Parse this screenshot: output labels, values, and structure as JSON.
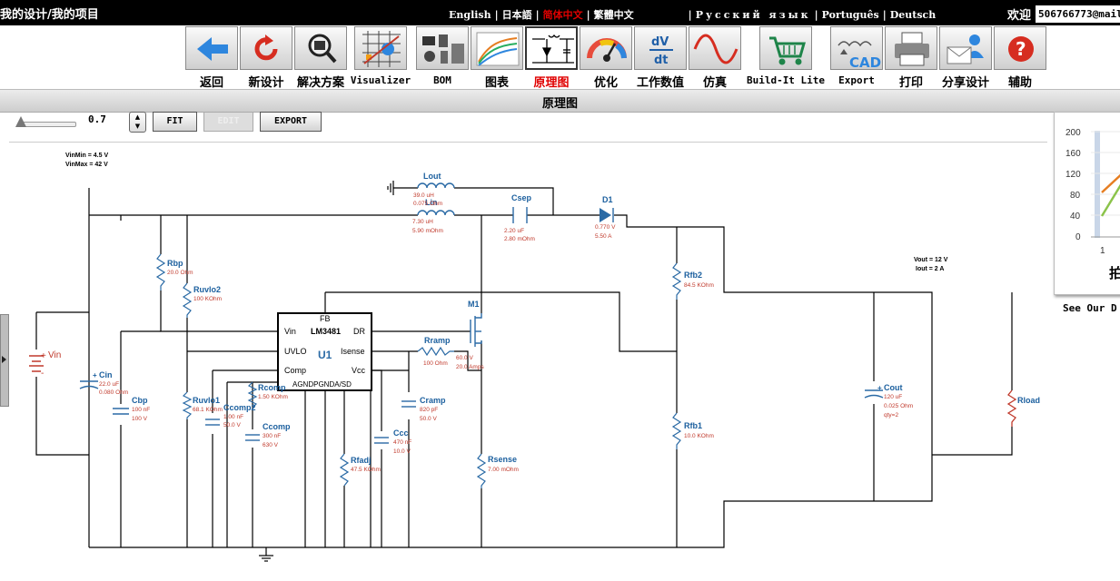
{
  "header": {
    "breadcrumb": "我的设计/我的项目",
    "languages": [
      "English",
      "日本語",
      "简体中文",
      "繁體中文",
      "Русский язык",
      "Português",
      "Deutsch"
    ],
    "active_language": "简体中文",
    "welcome": "欢迎",
    "user": "506766773@mail"
  },
  "toolbar": {
    "items": [
      {
        "key": "back",
        "label": "返回",
        "icon": "back-arrow-icon"
      },
      {
        "key": "new",
        "label": "新设计",
        "icon": "refresh-icon"
      },
      {
        "key": "solutions",
        "label": "解决方案",
        "icon": "magnifier-chip-icon"
      },
      {
        "key": "visualizer",
        "label": "Visualizer",
        "icon": "visualizer-icon"
      },
      {
        "key": "bom",
        "label": "BOM",
        "icon": "bom-icon"
      },
      {
        "key": "charts",
        "label": "图表",
        "icon": "chart-icon"
      },
      {
        "key": "schematic",
        "label": "原理图",
        "icon": "schematic-icon",
        "selected": true
      },
      {
        "key": "optimize",
        "label": "优化",
        "icon": "gauge-icon"
      },
      {
        "key": "opvalues",
        "label": "工作数值",
        "icon": "dvdt-icon"
      },
      {
        "key": "simulate",
        "label": "仿真",
        "icon": "sine-icon"
      },
      {
        "key": "buildit",
        "label": "Build-It Lite",
        "icon": "cart-icon"
      },
      {
        "key": "export",
        "label": "Export",
        "icon": "cad-icon"
      },
      {
        "key": "print",
        "label": "打印",
        "icon": "printer-icon"
      },
      {
        "key": "share",
        "label": "分享设计",
        "icon": "share-icon"
      },
      {
        "key": "help",
        "label": "辅助",
        "icon": "help-icon"
      }
    ]
  },
  "section_title": "原理图",
  "controls": {
    "zoom": "0.7",
    "fit": "FIT",
    "edit": "EDIT",
    "export": "EXPORT"
  },
  "schematic": {
    "vin_range": [
      "VinMin = 4.5 V",
      "VinMax = 42 V"
    ],
    "vout_info": [
      "Vout = 12 V",
      "Iout = 2 A"
    ],
    "source": {
      "name": "Vin"
    },
    "ic": {
      "name": "LM3481",
      "ref": "U1",
      "pins": {
        "fb": "FB",
        "vin": "Vin",
        "dr": "DR",
        "uvlo": "UVLO",
        "isense": "Isense",
        "comp": "Comp",
        "vcc": "Vcc",
        "bottom": "AGNDPGNDA/SD"
      }
    },
    "parts": {
      "lout": {
        "name": "Lout",
        "v1": "39.0 uH",
        "v2": "0.075 Ohm"
      },
      "lin": {
        "name": "Lin",
        "v1": "7.30 uH",
        "v2": "5.90 mOhm"
      },
      "csep": {
        "name": "Csep",
        "v1": "2.20 uF",
        "v2": "2.80 mOhm"
      },
      "d1": {
        "name": "D1",
        "v1": "0.770 V",
        "v2": "5.50 A"
      },
      "rbp": {
        "name": "Rbp",
        "v1": "20.0 Ohm"
      },
      "ruvlo2": {
        "name": "Ruvlo2",
        "v1": "100 KOhm"
      },
      "rfb2": {
        "name": "Rfb2",
        "v1": "84.5 KOhm"
      },
      "m1": {
        "name": "M1",
        "v1": "60.0 V",
        "v2": "20.0 Amps"
      },
      "rramp": {
        "name": "Rramp",
        "v1": "100 Ohm"
      },
      "cin": {
        "name": "Cin",
        "v1": "22.0 uF",
        "v2": "0.080 Ohm"
      },
      "cbp": {
        "name": "Cbp",
        "v1": "100 nF",
        "v2": "100 V"
      },
      "ruvlo1": {
        "name": "Ruvlo1",
        "v1": "68.1 KOhm"
      },
      "ccomp2": {
        "name": "Ccomp2",
        "v1": "1.00 nF",
        "v2": "50.0 V"
      },
      "rcomp": {
        "name": "Rcomp",
        "v1": "1.50 KOhm"
      },
      "ccomp": {
        "name": "Ccomp",
        "v1": "300 nF",
        "v2": "630 V"
      },
      "cramp": {
        "name": "Cramp",
        "v1": "820 pF",
        "v2": "50.0 V"
      },
      "ccc": {
        "name": "Ccc",
        "v1": "470 nF",
        "v2": "10.0 V"
      },
      "rfadj": {
        "name": "Rfadj",
        "v1": "47.5 KOhm"
      },
      "rsense": {
        "name": "Rsense",
        "v1": "7.00 mOhm"
      },
      "rfb1": {
        "name": "Rfb1",
        "v1": "10.0 KOhm"
      },
      "cout": {
        "name": "Cout",
        "v1": "120 uF",
        "v2": "0.025 Ohm",
        "v3": "qty=2"
      },
      "rload": {
        "name": "Rload"
      }
    }
  },
  "side_chart": {
    "yticks": [
      "200",
      "160",
      "120",
      "80",
      "40",
      "0"
    ],
    "xtick": "1",
    "title_fragment": "拍"
  },
  "see_our": "See Our D",
  "colors": {
    "accent_red": "#e00000",
    "part_blue": "#1b5f9e",
    "value_red": "#c0392b"
  }
}
